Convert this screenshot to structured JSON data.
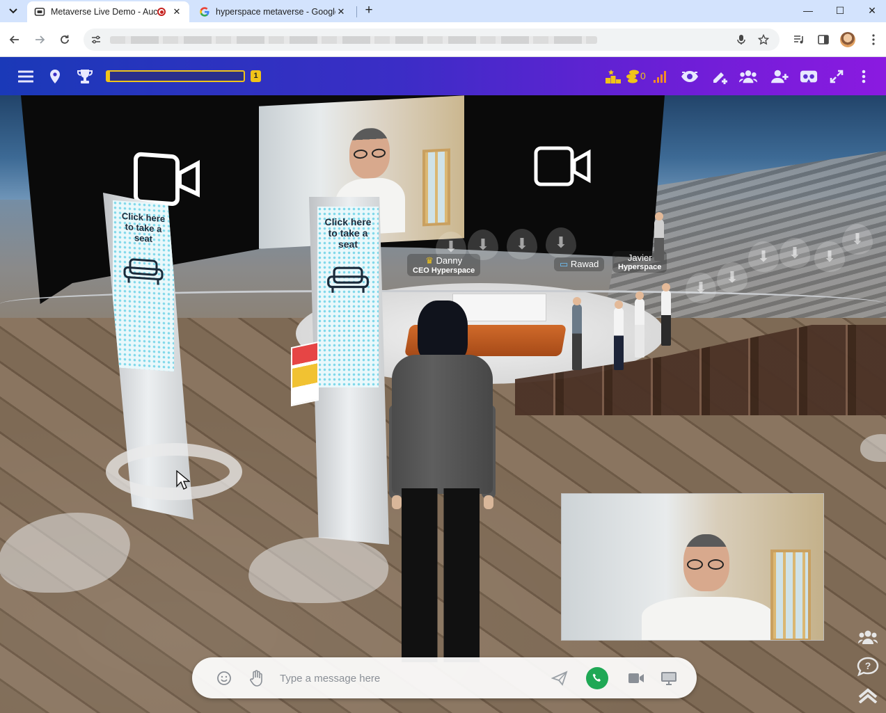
{
  "browser": {
    "tabs": [
      {
        "title": "Metaverse Live Demo - Auc",
        "active": true,
        "recording": true
      },
      {
        "title": "hyperspace metaverse - Google",
        "active": false
      }
    ],
    "new_tab_symbol": "+",
    "window_controls": {
      "minimize": "—",
      "maximize": "☐",
      "close": "✕"
    }
  },
  "app_bar": {
    "level": "1",
    "xp_progress_percent": 2,
    "coins": "0",
    "accent_color": "#f0c419"
  },
  "scene": {
    "kiosk_left_text": "Click here to take a seat",
    "kiosk_right_text": "Click here to take a seat",
    "name_tags": [
      {
        "name": "Danny",
        "title": "CEO Hyperspace",
        "badge": "crown-icon"
      },
      {
        "name": "Rawad",
        "badge": "laptop-icon"
      },
      {
        "name": "Javier",
        "title": "Hyperspace"
      }
    ]
  },
  "composer": {
    "placeholder": "Type a message here",
    "call_color": "#1fa855"
  }
}
